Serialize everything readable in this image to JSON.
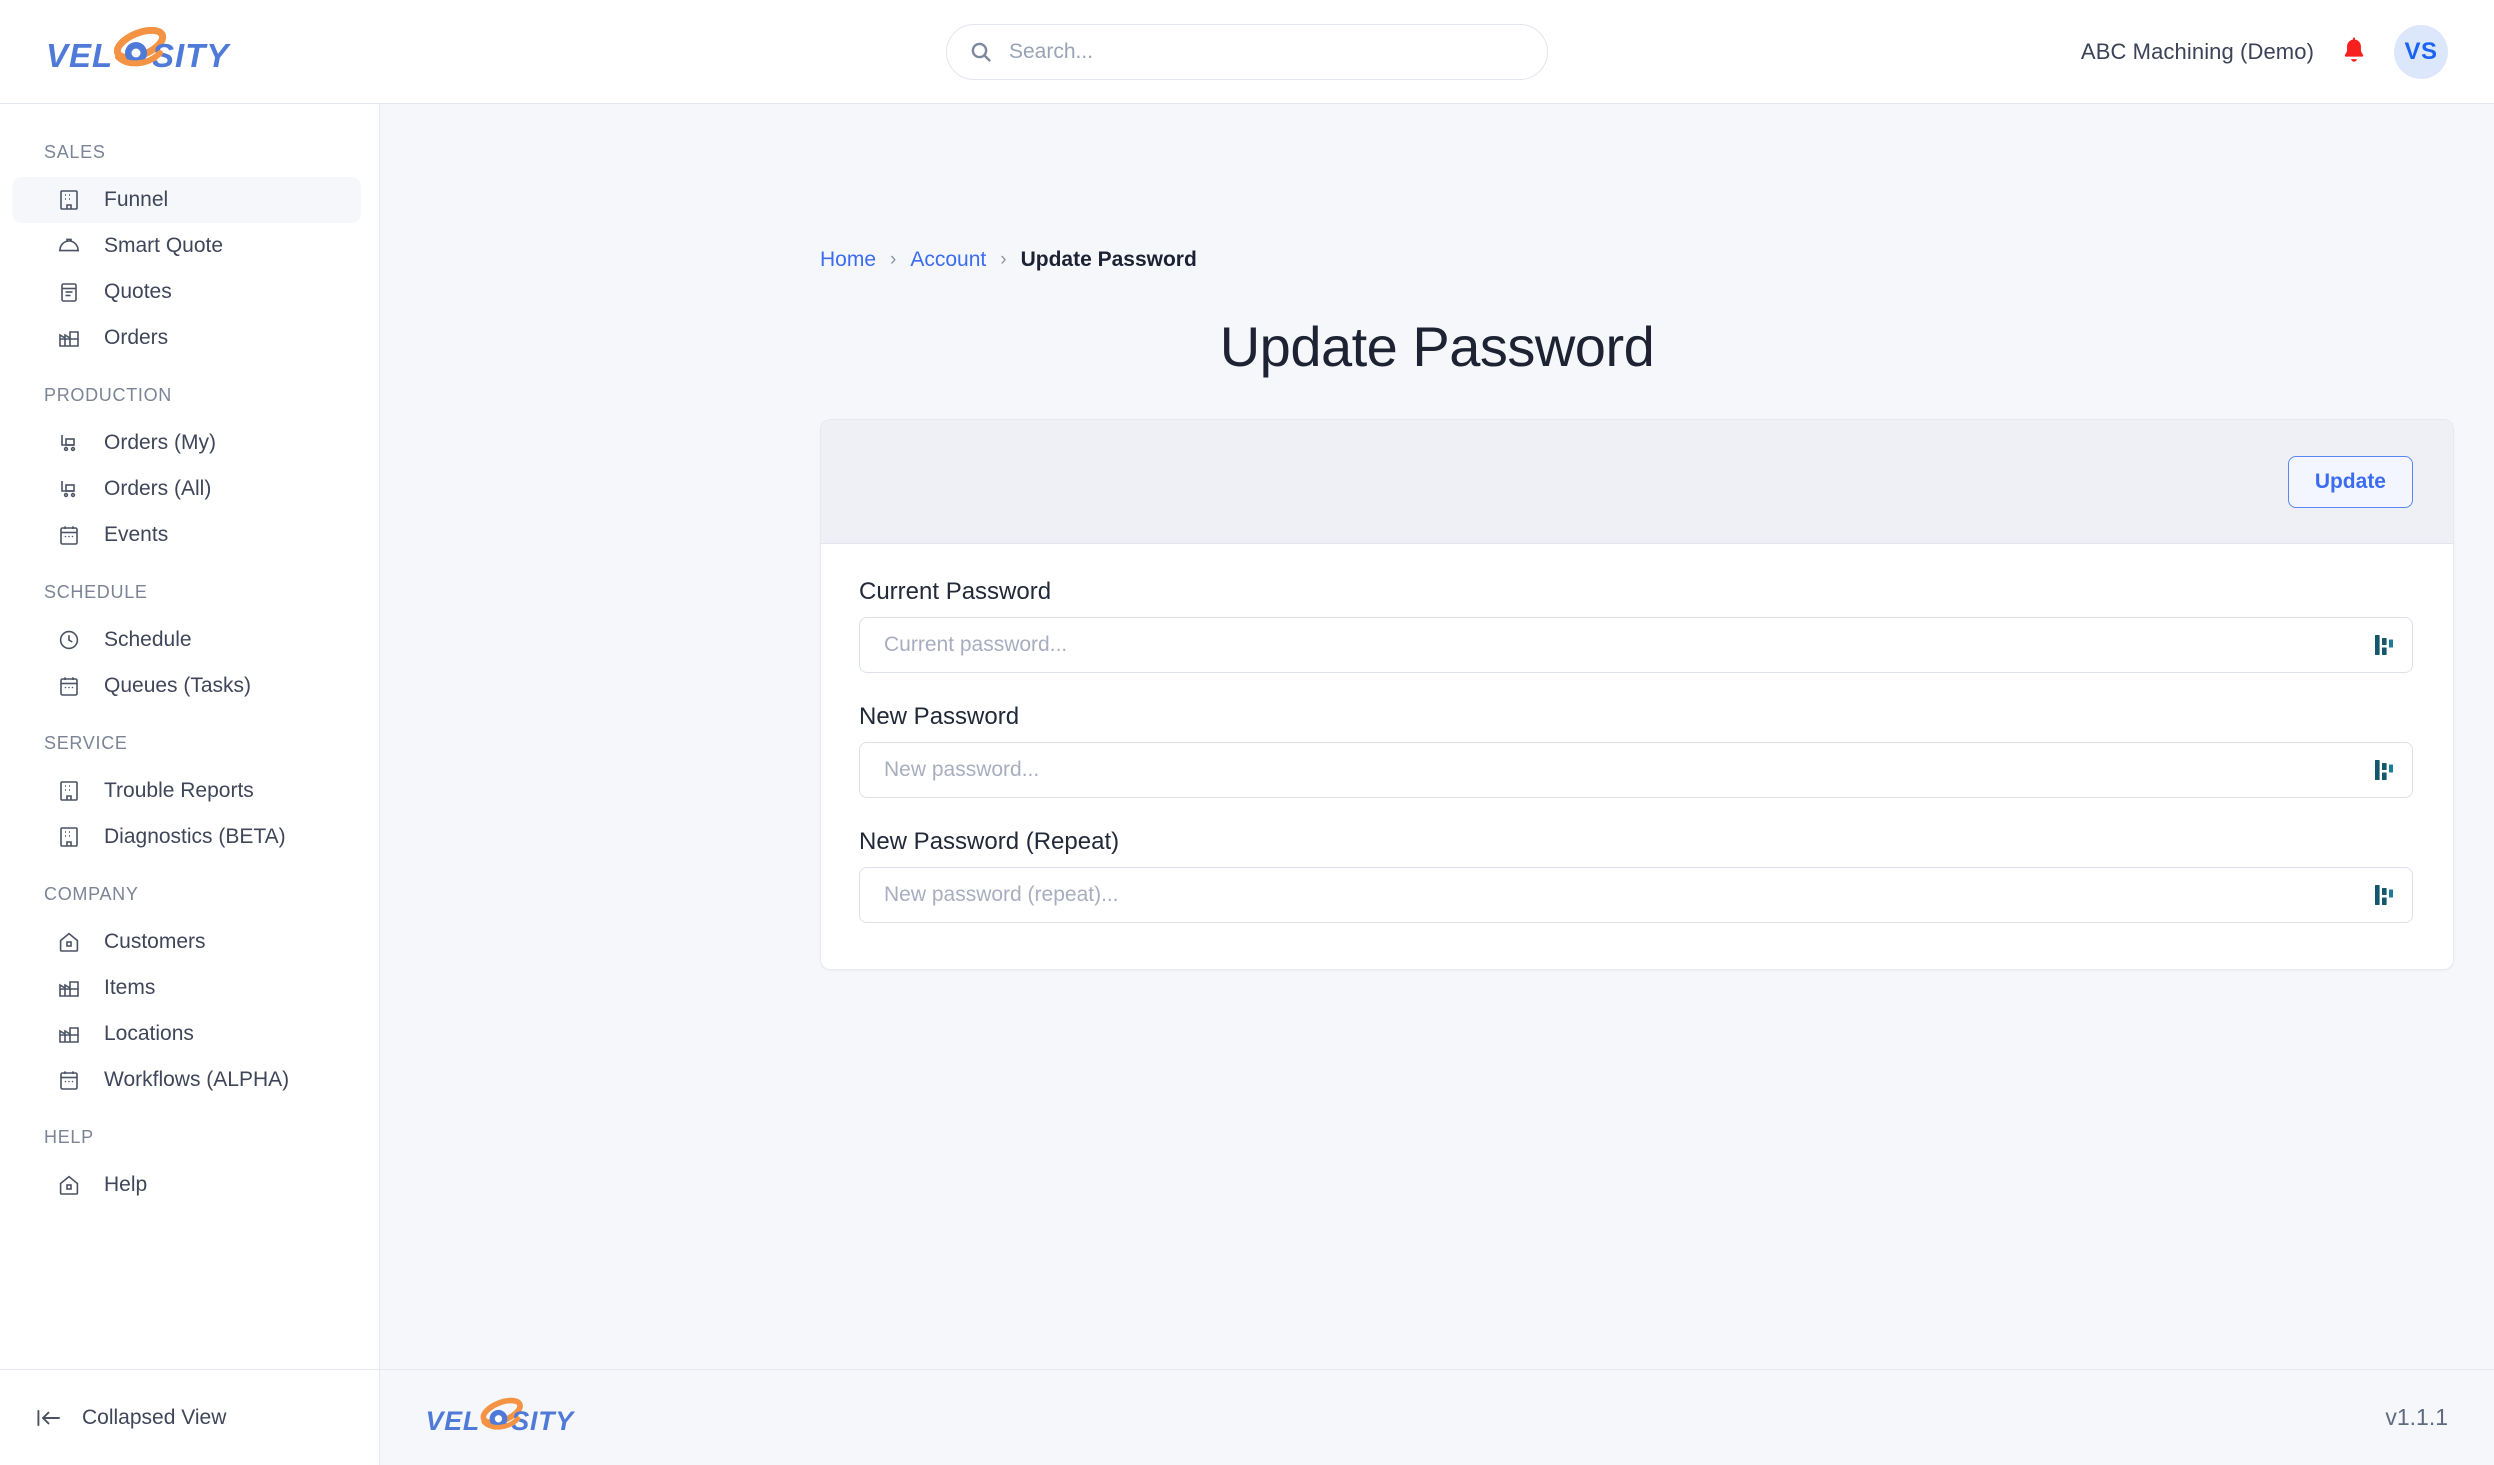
{
  "brand": {
    "name": "VELOSITY",
    "logo_blue": "#4f7ad8",
    "logo_orange": "#f59345"
  },
  "topbar": {
    "search": {
      "icon": "search-icon",
      "placeholder": "Search...",
      "value": ""
    },
    "org_name": "ABC Machining (Demo)",
    "notification_icon": "bell-icon",
    "notification_color": "#f81f1f",
    "avatar_initials": "VS",
    "avatar_bg": "#dde7fb",
    "avatar_color": "#1b63f2"
  },
  "sidebar": {
    "groups": [
      {
        "title": "SALES",
        "items": [
          {
            "label": "Funnel",
            "icon": "building-icon",
            "active": true
          },
          {
            "label": "Smart Quote",
            "icon": "hard-hat-icon",
            "active": false
          },
          {
            "label": "Quotes",
            "icon": "clipboard-icon",
            "active": false
          },
          {
            "label": "Orders",
            "icon": "factory-icon",
            "active": false
          }
        ]
      },
      {
        "title": "PRODUCTION",
        "items": [
          {
            "label": "Orders (My)",
            "icon": "cart-icon",
            "active": false
          },
          {
            "label": "Orders (All)",
            "icon": "cart-icon",
            "active": false
          },
          {
            "label": "Events",
            "icon": "calendar-icon",
            "active": false
          }
        ]
      },
      {
        "title": "SCHEDULE",
        "items": [
          {
            "label": "Schedule",
            "icon": "clock-icon",
            "active": false
          },
          {
            "label": "Queues (Tasks)",
            "icon": "calendar-icon",
            "active": false
          }
        ]
      },
      {
        "title": "SERVICE",
        "items": [
          {
            "label": "Trouble Reports",
            "icon": "building-icon",
            "active": false
          },
          {
            "label": "Diagnostics (BETA)",
            "icon": "building-icon",
            "active": false
          }
        ]
      },
      {
        "title": "COMPANY",
        "items": [
          {
            "label": "Customers",
            "icon": "home-icon",
            "active": false
          },
          {
            "label": "Items",
            "icon": "factory-icon",
            "active": false
          },
          {
            "label": "Locations",
            "icon": "factory-icon",
            "active": false
          },
          {
            "label": "Workflows (ALPHA)",
            "icon": "calendar-icon",
            "active": false
          }
        ]
      },
      {
        "title": "HELP",
        "items": [
          {
            "label": "Help",
            "icon": "home-icon",
            "active": false
          }
        ]
      }
    ],
    "collapse": {
      "label": "Collapsed View",
      "icon": "collapse-left-icon"
    }
  },
  "main": {
    "breadcrumb": [
      {
        "label": "Home",
        "type": "link"
      },
      {
        "label": "Account",
        "type": "link"
      },
      {
        "label": "Update Password",
        "type": "current"
      }
    ],
    "breadcrumb_separator": "›",
    "page_title": "Update Password",
    "card": {
      "update_button": "Update",
      "fields": [
        {
          "label": "Current Password",
          "placeholder": "Current password...",
          "value": "",
          "icon": "password-manager-icon"
        },
        {
          "label": "New Password",
          "placeholder": "New password...",
          "value": "",
          "icon": "password-manager-icon"
        },
        {
          "label": "New Password (Repeat)",
          "placeholder": "New password (repeat)...",
          "value": "",
          "icon": "password-manager-icon"
        }
      ]
    }
  },
  "footer": {
    "logo_name": "VELOSITY",
    "version": "v1.1.1"
  }
}
